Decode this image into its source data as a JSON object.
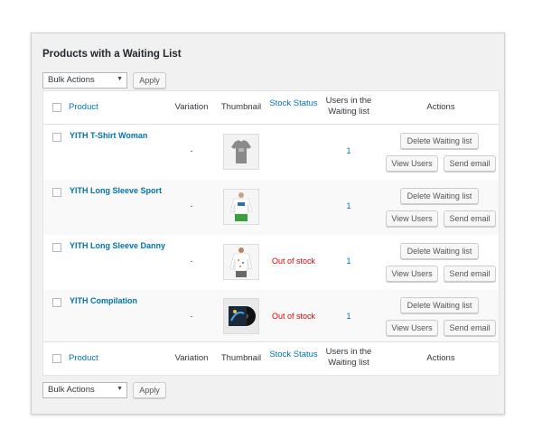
{
  "panel": {
    "title": "Products with a Waiting List"
  },
  "bulk_top": {
    "selected": "Bulk Actions",
    "apply": "Apply"
  },
  "bulk_bottom": {
    "selected": "Bulk Actions",
    "apply": "Apply"
  },
  "columns": {
    "product": "Product",
    "variation": "Variation",
    "thumbnail": "Thumbnail",
    "stock_status": "Stock Status",
    "users_line1": "Users in the",
    "users_line2": "Waiting list",
    "actions": "Actions"
  },
  "actions": {
    "delete": "Delete Waiting list",
    "view": "View Users",
    "send": "Send email"
  },
  "rows": [
    {
      "name": "YITH T-Shirt Woman",
      "variation": "-",
      "stock": "",
      "users": "1",
      "thumb_icon": "tshirt-icon"
    },
    {
      "name": "YITH Long Sleeve Sport",
      "variation": "-",
      "stock": "",
      "users": "1",
      "thumb_icon": "long-sleeve-icon"
    },
    {
      "name": "YITH Long Sleeve Danny",
      "variation": "-",
      "stock": "Out of stock",
      "users": "1",
      "thumb_icon": "long-sleeve-icon"
    },
    {
      "name": "YITH Compilation",
      "variation": "-",
      "stock": "Out of stock",
      "users": "1",
      "thumb_icon": "vinyl-record-icon"
    }
  ],
  "colors": {
    "link": "#0073aa",
    "out_of_stock": "#e00000",
    "panel_bg": "#f1f1f1"
  }
}
